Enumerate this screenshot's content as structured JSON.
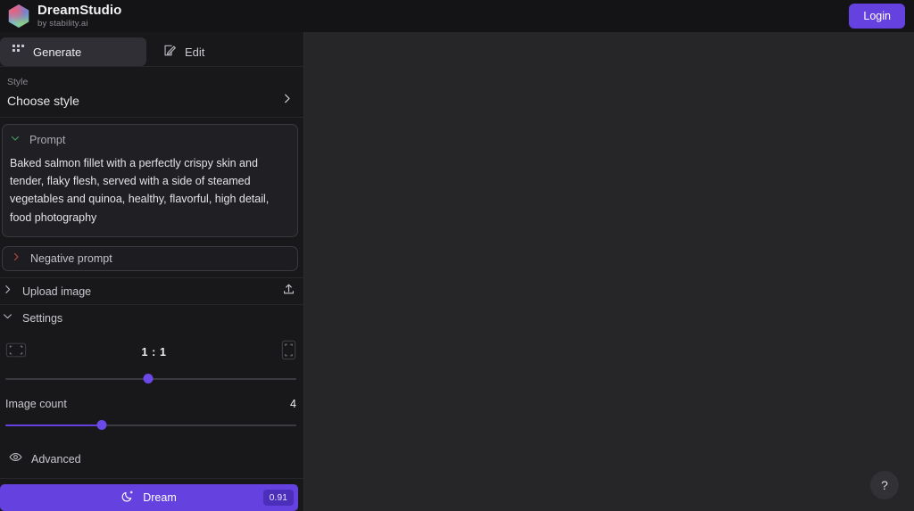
{
  "header": {
    "brand_title": "DreamStudio",
    "brand_subtitle": "by stability.ai",
    "logo_icon": "hexagon-gradient-logo",
    "login_label": "Login",
    "accent_color": "#6542e0"
  },
  "sidebar": {
    "tabs": [
      {
        "label": "Generate",
        "icon": "grid-squares-icon",
        "active": true
      },
      {
        "label": "Edit",
        "icon": "pencil-square-icon",
        "active": false
      }
    ],
    "style": {
      "label": "Style",
      "value": "Choose style",
      "chevron_icon": "chevron-right-icon"
    },
    "prompt": {
      "caption": "Prompt",
      "chevron_icon": "chevron-down-icon",
      "chevron_color": "#3f9e62",
      "text": "Baked salmon fillet with a perfectly crispy skin and tender, flaky flesh, served with a side of steamed vegetables and quinoa, healthy, flavorful, high detail, food photography"
    },
    "negative_prompt": {
      "caption": "Negative prompt",
      "chevron_icon": "chevron-right-icon",
      "chevron_color": "#b5483f"
    },
    "upload_image": {
      "caption": "Upload image",
      "chevron_icon": "chevron-right-icon",
      "upload_icon": "upload-arrow-icon"
    },
    "settings": {
      "caption": "Settings",
      "chevron_icon": "chevron-down-icon",
      "aspect_ratio": {
        "value": "1 : 1",
        "landscape_icon": "landscape-frame-icon",
        "portrait_icon": "portrait-frame-icon",
        "slider_percent": 49
      },
      "image_count": {
        "label": "Image count",
        "value": "4",
        "slider_percent": 33
      }
    },
    "advanced": {
      "label": "Advanced",
      "icon": "eye-icon"
    },
    "dream": {
      "label": "Dream",
      "icon": "crescent-moon-sparkle-icon",
      "cost": "0.91"
    }
  },
  "canvas": {
    "help_label": "?",
    "help_icon": "question-mark-icon"
  }
}
